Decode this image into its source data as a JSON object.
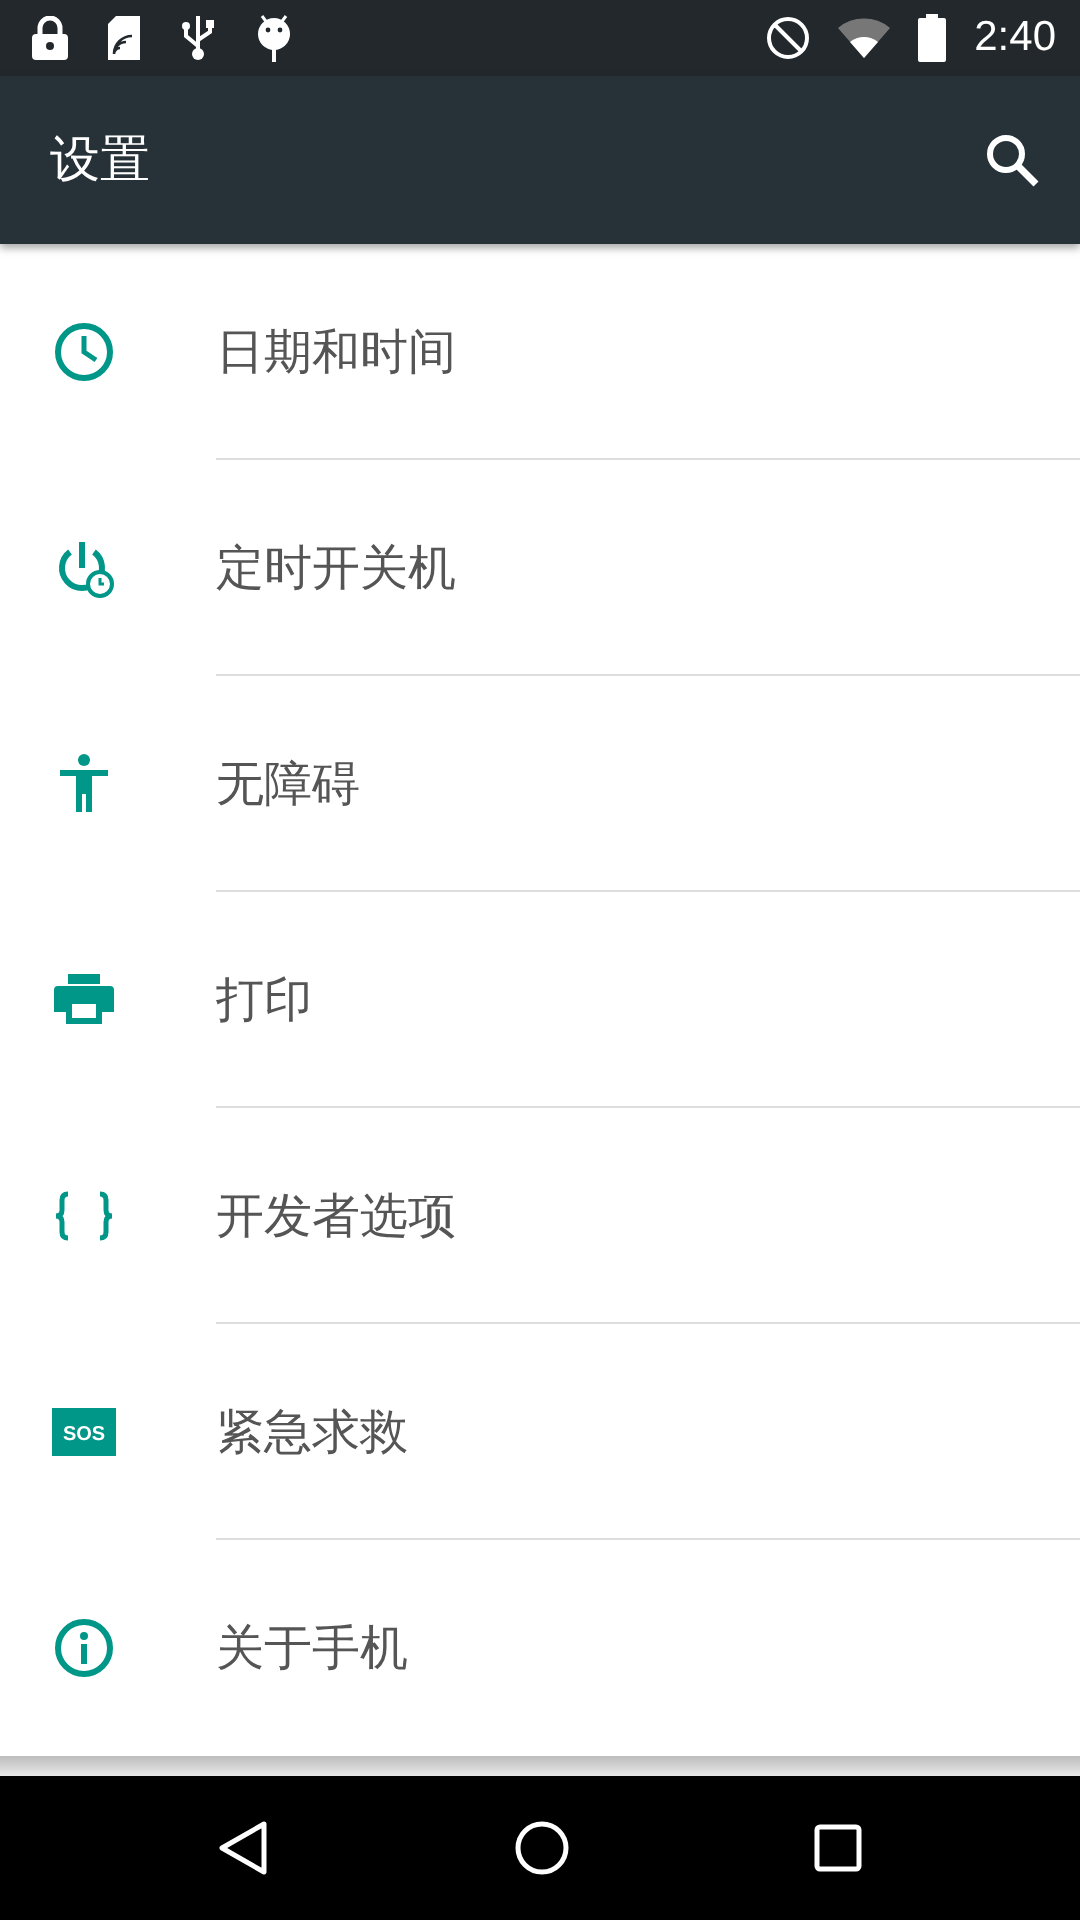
{
  "status_bar": {
    "time": "2:40"
  },
  "toolbar": {
    "title": "设置"
  },
  "items": [
    {
      "kind": "clock",
      "label": "日期和时间"
    },
    {
      "kind": "power-timer",
      "label": "定时开关机"
    },
    {
      "kind": "accessibility",
      "label": "无障碍"
    },
    {
      "kind": "print",
      "label": "打印"
    },
    {
      "kind": "braces",
      "label": "开发者选项"
    },
    {
      "kind": "sos",
      "label": "紧急求救",
      "icon_text": "SOS"
    },
    {
      "kind": "info",
      "label": "关于手机"
    }
  ]
}
